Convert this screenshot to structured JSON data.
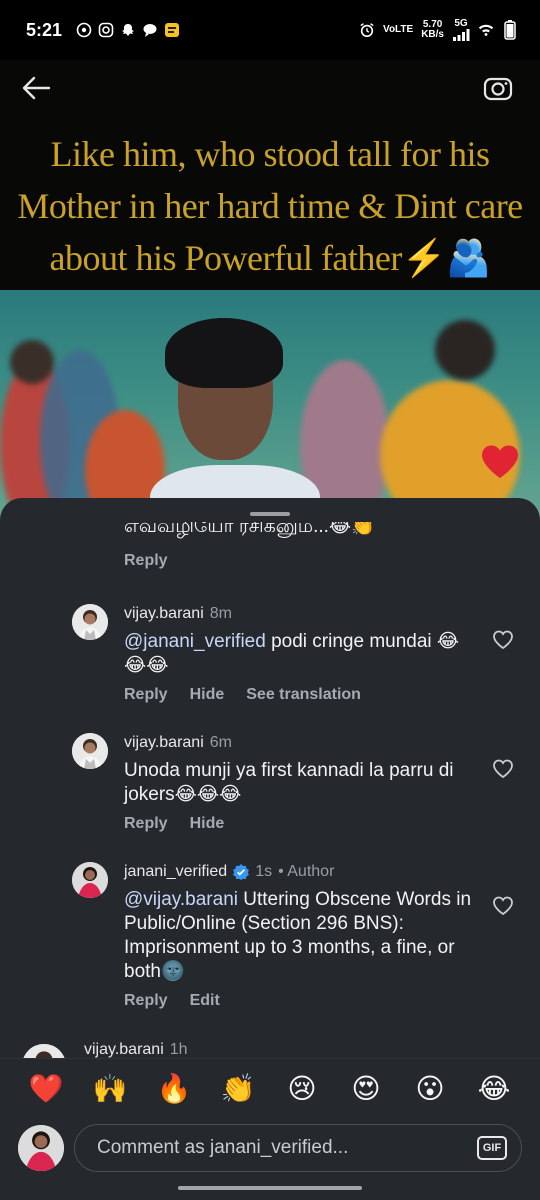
{
  "status_bar": {
    "time": "5:21",
    "net_top": "VoLTE",
    "speed_value": "5.70",
    "speed_unit": "KB/s",
    "network": "5G"
  },
  "video": {
    "caption_lines": [
      "Like him, who stood tall for his",
      "Mother in her hard time & Dint care",
      "about his Powerful father⚡🫂"
    ]
  },
  "comments": {
    "partial": {
      "text": "எவ்வழியோ ரசிகனும...😂👏",
      "reply_label": "Reply"
    },
    "items": [
      {
        "username": "vijay.barani",
        "time": "8m",
        "mention": "@janani_verified",
        "text": " podi cringe mundai 😂😂😂",
        "actions": [
          "Reply",
          "Hide",
          "See translation"
        ]
      },
      {
        "username": "vijay.barani",
        "time": "6m",
        "mention": "",
        "text": "Unoda munji ya first kannadi la parru di jokers😂😂😂",
        "actions": [
          "Reply",
          "Hide"
        ]
      },
      {
        "username": "janani_verified",
        "time": "1s",
        "author_tag": "• Author",
        "mention": "@vijay.barani",
        "text": " Uttering Obscene Words in Public/Online (Section 296 BNS): Imprisonment up to 3 months, a fine, or both🌚",
        "actions": [
          "Reply",
          "Edit"
        ]
      },
      {
        "username": "vijay.barani",
        "time": "1h"
      }
    ]
  },
  "emoji_bar": [
    "❤️",
    "🙌",
    "🔥",
    "👏",
    "😢",
    "😍",
    "😮",
    "😂"
  ],
  "composer": {
    "placeholder": "Comment as janani_verified...",
    "gif_label": "GIF"
  },
  "colors": {
    "sheet_bg": "#25282d",
    "caption_gold": "#c9a227",
    "mention": "#c7d7f7",
    "heart": "#e02434",
    "verified": "#3797f0"
  }
}
